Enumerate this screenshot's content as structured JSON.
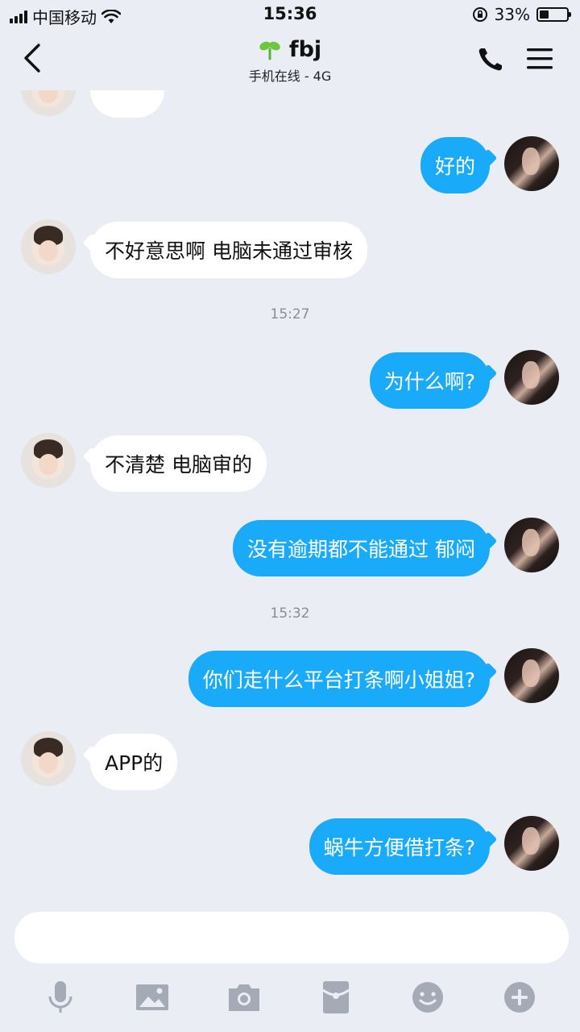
{
  "status_bar": {
    "carrier": "中国移动",
    "time": "15:36",
    "battery": "33%",
    "battery_level": 0.33
  },
  "nav": {
    "title": "fbj",
    "subtitle": "手机在线 - 4G"
  },
  "messages": [
    {
      "side": "in",
      "text": ""
    },
    {
      "side": "out",
      "text": "好的"
    },
    {
      "side": "in",
      "text": "不好意思啊 电脑未通过审核"
    },
    {
      "timestamp": "15:27"
    },
    {
      "side": "out",
      "text": "为什么啊?"
    },
    {
      "side": "in",
      "text": "不清楚 电脑审的"
    },
    {
      "side": "out",
      "text": "没有逾期都不能通过 郁闷"
    },
    {
      "timestamp": "15:32"
    },
    {
      "side": "out",
      "text": "你们走什么平台打条啊小姐姐?"
    },
    {
      "side": "in",
      "text": "APP的"
    },
    {
      "side": "out",
      "text": "蜗牛方便借打条?"
    }
  ],
  "composer": {
    "value": "",
    "placeholder": ""
  },
  "colors": {
    "accent": "#1aaafa",
    "background": "#ebedf5",
    "icon": "#a5aab7"
  }
}
